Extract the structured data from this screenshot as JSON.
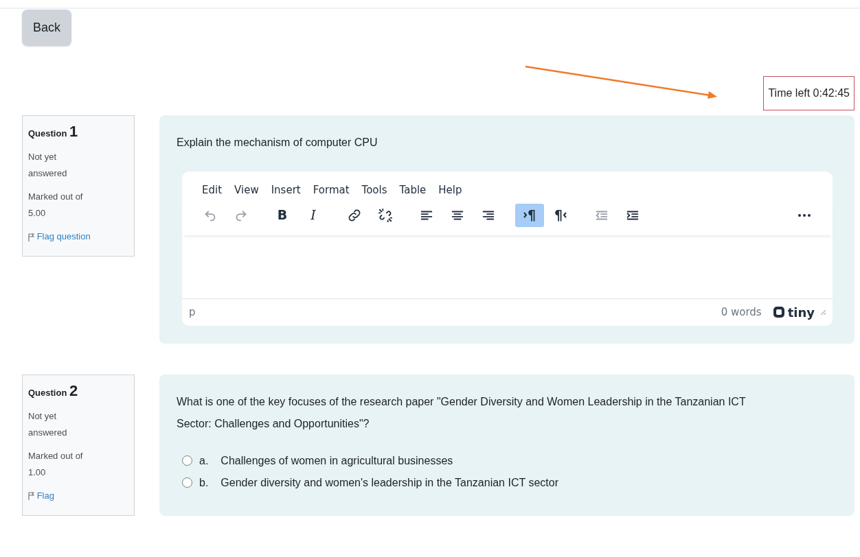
{
  "back_button": "Back",
  "timer": {
    "label": "Time left 0:42:45"
  },
  "questions": [
    {
      "heading": "Question",
      "number": "1",
      "status": "Not yet answered",
      "marks": "Marked out of 5.00",
      "flag": "Flag question",
      "kind": "essay",
      "text": "Explain the mechanism of computer CPU",
      "editor": {
        "menu": [
          "Edit",
          "View",
          "Insert",
          "Format",
          "Tools",
          "Table",
          "Help"
        ],
        "toolbar": [
          [
            {
              "kind": "undo",
              "disabled": true,
              "active": false
            },
            {
              "kind": "redo",
              "disabled": true,
              "active": false
            }
          ],
          [
            {
              "kind": "bold",
              "glyph": "B",
              "disabled": false,
              "active": false
            },
            {
              "kind": "italic",
              "glyph": "I",
              "disabled": false,
              "active": false
            }
          ],
          [
            {
              "kind": "link",
              "disabled": false,
              "active": false
            },
            {
              "kind": "unlink",
              "disabled": false,
              "active": false
            }
          ],
          [
            {
              "kind": "align-left",
              "disabled": false,
              "active": false
            },
            {
              "kind": "align-center",
              "disabled": false,
              "active": false
            },
            {
              "kind": "align-right",
              "disabled": false,
              "active": false
            }
          ],
          [
            {
              "kind": "ltr",
              "glyph": "¶",
              "disabled": false,
              "active": true
            },
            {
              "kind": "rtl",
              "glyph": "¶",
              "disabled": false,
              "active": false
            }
          ],
          [
            {
              "kind": "outdent",
              "disabled": true,
              "active": false
            },
            {
              "kind": "indent",
              "disabled": false,
              "active": false
            }
          ],
          [
            {
              "kind": "more",
              "disabled": false,
              "active": false
            }
          ]
        ],
        "path": "p",
        "word_count": "0 words",
        "brand": "tiny"
      }
    },
    {
      "heading": "Question",
      "number": "2",
      "status": "Not yet answered",
      "marks": "Marked out of 1.00",
      "flag": "Flag",
      "kind": "choice",
      "text": "What is one of the key focuses of the research paper \"Gender Diversity and Women Leadership in the Tanzanian ICT Sector: Challenges and Opportunities\"?",
      "options": [
        {
          "letter": "a.",
          "label": "Challenges of women in agricultural businesses",
          "selected": false
        },
        {
          "letter": "b.",
          "label": "Gender diversity and women's leadership in the Tanzanian ICT sector",
          "selected": false
        }
      ]
    }
  ]
}
